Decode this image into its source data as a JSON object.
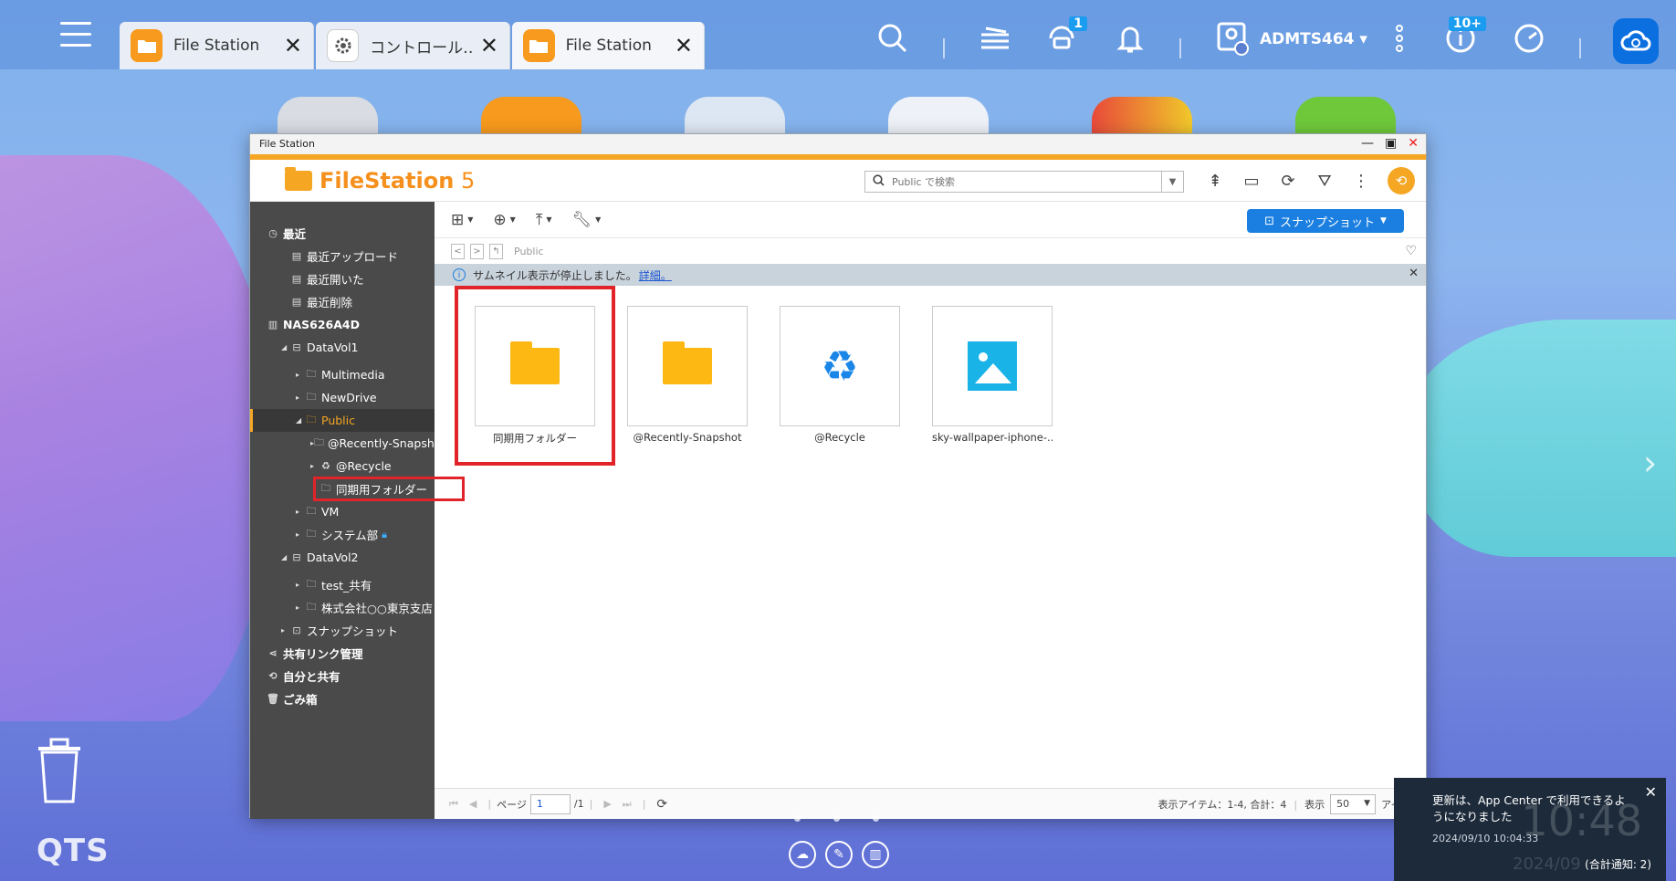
{
  "taskbar": {
    "tabs": [
      {
        "label": "File Station",
        "icon": "folder-icon"
      },
      {
        "label": "コントロール…",
        "icon": "gear-icon"
      },
      {
        "label": "File Station",
        "icon": "folder-icon"
      }
    ],
    "close_label": "✕",
    "task_badge": "1",
    "username": "ADMTS464",
    "update_badge": "10+"
  },
  "window": {
    "title": "File Station",
    "brand_name": "FileStation",
    "brand_version": " 5",
    "search_placeholder": "Public で検索"
  },
  "sidebar": {
    "items": [
      {
        "label": "最近"
      },
      {
        "label": "最近アップロード"
      },
      {
        "label": "最近開いた"
      },
      {
        "label": "最近削除"
      },
      {
        "label": "NAS626A4D"
      },
      {
        "label": "DataVol1"
      },
      {
        "label": "Multimedia"
      },
      {
        "label": "NewDrive"
      },
      {
        "label": "Public"
      },
      {
        "label": "@Recently-Snapshot"
      },
      {
        "label": "@Recycle"
      },
      {
        "label": "同期用フォルダー"
      },
      {
        "label": "VM"
      },
      {
        "label": "システム部"
      },
      {
        "label": "DataVol2"
      },
      {
        "label": "test_共有"
      },
      {
        "label": "株式会社○○東京支店"
      },
      {
        "label": "スナップショット"
      },
      {
        "label": "共有リンク管理"
      },
      {
        "label": "自分と共有"
      },
      {
        "label": "ごみ箱"
      }
    ]
  },
  "toolbar": {
    "snapshot_label": "スナップショット"
  },
  "path": {
    "current": "Public"
  },
  "notice": {
    "text": "サムネイル表示が停止しました。",
    "link": "詳細。"
  },
  "files": [
    {
      "name": "同期用フォルダー",
      "type": "folder"
    },
    {
      "name": "@Recently-Snapshot",
      "type": "folder"
    },
    {
      "name": "@Recycle",
      "type": "recycle"
    },
    {
      "name": "sky-wallpaper-iphone-...",
      "type": "image"
    }
  ],
  "footer": {
    "page_label": "ページ",
    "page_value": "1",
    "page_total": "/1",
    "items_text": "表示アイテム：1-4, 合計：4",
    "show_label": "表示",
    "per_page": "50",
    "items_label": "アイテム"
  },
  "desktop": {
    "logo": "QTS"
  },
  "toast": {
    "message": "更新は、App Center で利用できるようになりました",
    "time": "2024/09/10 10:04:33",
    "count": "(合計通知: 2)",
    "clock": "10:48",
    "date_ghost": "2024/09"
  },
  "colors": {
    "accent": "#f5a623",
    "primary_blue": "#1a7fe0",
    "highlight_red": "#e0242a"
  }
}
